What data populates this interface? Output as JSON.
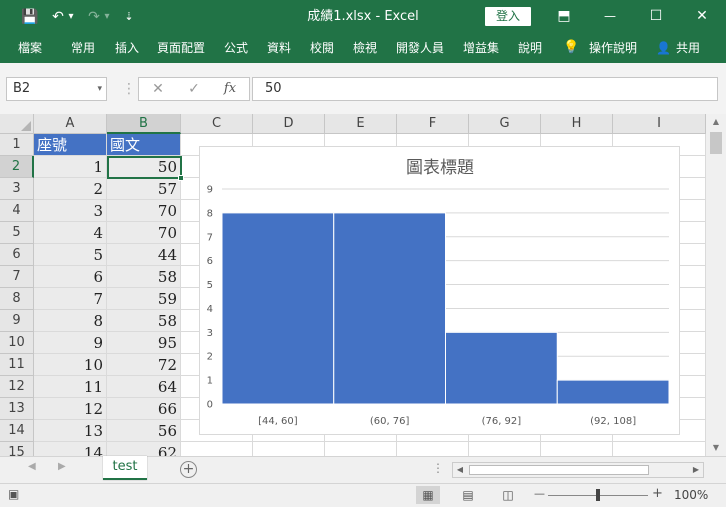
{
  "window": {
    "title": "成績1.xlsx  -  Excel",
    "login_label": "登入",
    "quick_access": {
      "save": "💾",
      "undo": "↶",
      "undo_dd": "▾",
      "redo": "↷",
      "redo_dd": "▾",
      "customize": "⇣"
    },
    "controls": {
      "restore_ribbon": "⬒",
      "minimize": "—",
      "maximize": "☐",
      "close": "✕"
    }
  },
  "ribbon": {
    "tabs": [
      "檔案",
      "常用",
      "插入",
      "頁面配置",
      "公式",
      "資料",
      "校閱",
      "檢視",
      "開發人員",
      "增益集",
      "說明"
    ],
    "tell_me": "操作說明",
    "share": "共用",
    "bulb_icon": "💡",
    "share_icon": "👤"
  },
  "formula_bar": {
    "name_box": "B2",
    "dropdown": "▾",
    "separator": "⋮",
    "cancel": "✕",
    "enter": "✓",
    "fx": "fx",
    "value": "50"
  },
  "sheet": {
    "columns": [
      "A",
      "B",
      "C",
      "D",
      "E",
      "F",
      "G",
      "H",
      "I"
    ],
    "rows": [
      "1",
      "2",
      "3",
      "4",
      "5",
      "6",
      "7",
      "8",
      "9",
      "10",
      "11",
      "12",
      "13",
      "14",
      "15"
    ],
    "selected_column": "B",
    "selected_row": "2",
    "header": [
      "座號",
      "國文"
    ],
    "data": [
      [
        "1",
        "50"
      ],
      [
        "2",
        "57"
      ],
      [
        "3",
        "70"
      ],
      [
        "4",
        "70"
      ],
      [
        "5",
        "44"
      ],
      [
        "6",
        "58"
      ],
      [
        "7",
        "59"
      ],
      [
        "8",
        "58"
      ],
      [
        "9",
        "95"
      ],
      [
        "10",
        "72"
      ],
      [
        "11",
        "64"
      ],
      [
        "12",
        "66"
      ],
      [
        "13",
        "56"
      ],
      [
        "14",
        "62"
      ]
    ]
  },
  "chart_data": {
    "type": "bar",
    "title": "圖表標題",
    "categories": [
      "[44, 60]",
      "(60, 76]",
      "(76, 92]",
      "(92, 108]"
    ],
    "values": [
      8,
      8,
      3,
      1
    ],
    "ylim": [
      0,
      9
    ],
    "yticks": [
      "0",
      "1",
      "2",
      "3",
      "4",
      "5",
      "6",
      "7",
      "8",
      "9"
    ],
    "grid": true,
    "bar_color": "#4472c4",
    "gap": "none"
  },
  "tabs": {
    "nav_prev": "◀",
    "nav_next": "▶",
    "sheet_name": "test",
    "add_sheet": "+",
    "dots": "⋮",
    "hscroll_left": "◀",
    "hscroll_right": "▶"
  },
  "status": {
    "ready_icon": "▣",
    "view_normal": "▦",
    "view_page_layout": "▤",
    "view_page_break": "◫",
    "zoom_minus": "—",
    "zoom_plus": "+",
    "zoom": "100%"
  },
  "colors": {
    "excel_green": "#217346",
    "accent_blue": "#4472c4"
  }
}
